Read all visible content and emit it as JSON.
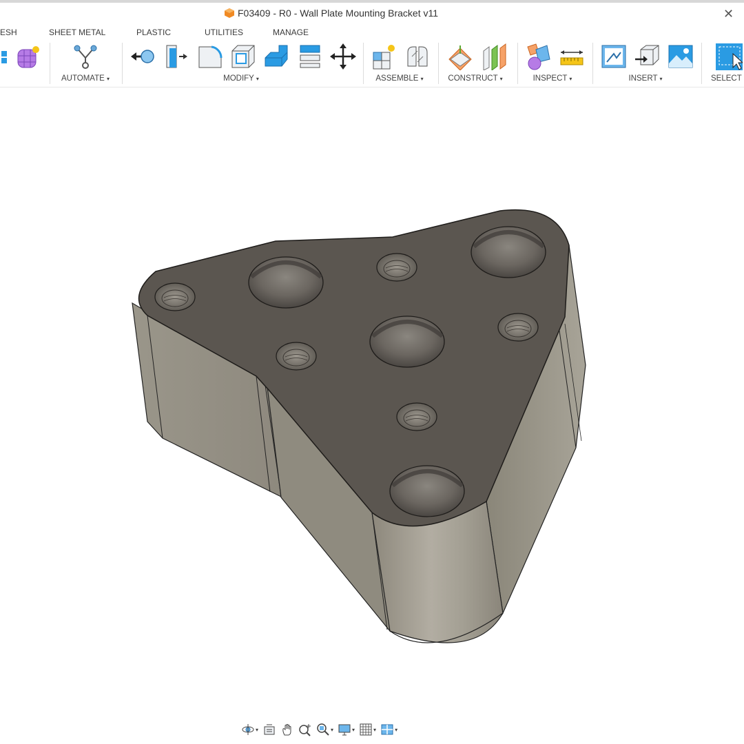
{
  "window": {
    "title": "F03409 - R0 - Wall Plate Mounting Bracket v11",
    "close_glyph": "✕"
  },
  "tabs": [
    {
      "label": "ESH"
    },
    {
      "label": "SHEET METAL"
    },
    {
      "label": "PLASTIC"
    },
    {
      "label": "UTILITIES"
    },
    {
      "label": "MANAGE"
    }
  ],
  "groups": {
    "automate": "AUTOMATE",
    "modify": "MODIFY",
    "assemble": "ASSEMBLE",
    "construct": "CONSTRUCT",
    "inspect": "INSPECT",
    "insert": "INSERT",
    "select": "SELECT"
  },
  "caret": "▾",
  "icons": {
    "create-tools": [
      "box-icon",
      "form-icon"
    ],
    "automate": [
      "automate-icon"
    ],
    "modify": [
      "press-pull-icon",
      "fillet-icon",
      "chamfer-icon",
      "shell-icon",
      "draft-icon",
      "scale-icon",
      "move-icon"
    ],
    "assemble": [
      "new-component-icon",
      "joint-icon"
    ],
    "construct": [
      "offset-plane-icon",
      "midplane-icon"
    ],
    "inspect": [
      "interference-icon",
      "measure-icon"
    ],
    "insert": [
      "insert-canvas-icon",
      "insert-mesh-icon",
      "decal-icon"
    ],
    "select": [
      "select-icon"
    ]
  },
  "navbar": [
    "orbit-icon",
    "look-at-icon",
    "pan-icon",
    "zoom-icon",
    "fit-icon",
    "display-settings-icon",
    "grid-icon",
    "viewports-icon"
  ],
  "colors": {
    "top_face": "#5b5650",
    "side_face": "#9a968a",
    "accent_blue": "#2a9be3",
    "orange": "#f08a24"
  }
}
